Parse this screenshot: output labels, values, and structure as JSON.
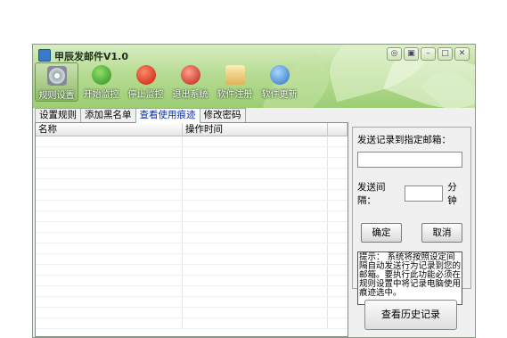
{
  "window": {
    "title": "甲辰发邮件V1.0"
  },
  "titlebar_buttons": [
    {
      "icon": "skin-icon",
      "glyph": "◎"
    },
    {
      "icon": "menu-icon",
      "glyph": "▣"
    },
    {
      "icon": "minimize-icon",
      "glyph": "–"
    },
    {
      "icon": "maximize-icon",
      "glyph": "□"
    },
    {
      "icon": "close-icon",
      "glyph": "✕"
    }
  ],
  "toolbar": [
    {
      "label": "规则设置",
      "icon": "gear-icon",
      "active": true
    },
    {
      "label": "开始监控",
      "icon": "play-icon"
    },
    {
      "label": "停止监控",
      "icon": "stop-icon"
    },
    {
      "label": "退出系统",
      "icon": "logout-icon"
    },
    {
      "label": "软件注册",
      "icon": "register-icon"
    },
    {
      "label": "软件更新",
      "icon": "update-icon"
    }
  ],
  "tabs": [
    {
      "label": "设置规则"
    },
    {
      "label": "添加黑名单"
    },
    {
      "label": "查看使用痕迹",
      "active": true
    },
    {
      "label": "修改密码"
    }
  ],
  "list": {
    "columns": [
      "名称",
      "操作时间"
    ],
    "rows": []
  },
  "panel": {
    "email_label": "发送记录到指定邮箱：",
    "email_value": "",
    "interval_label": "发送间隔：",
    "interval_value": "",
    "interval_unit": "分钟",
    "confirm_label": "确定",
    "cancel_label": "取消",
    "tip_text": "提示：        系统将按照设定间隔自动发送行为记录到您的邮箱。要执行此功能必须在规则设置中将记录电脑使用痕迹选中。",
    "history_label": "查看历史记录"
  }
}
